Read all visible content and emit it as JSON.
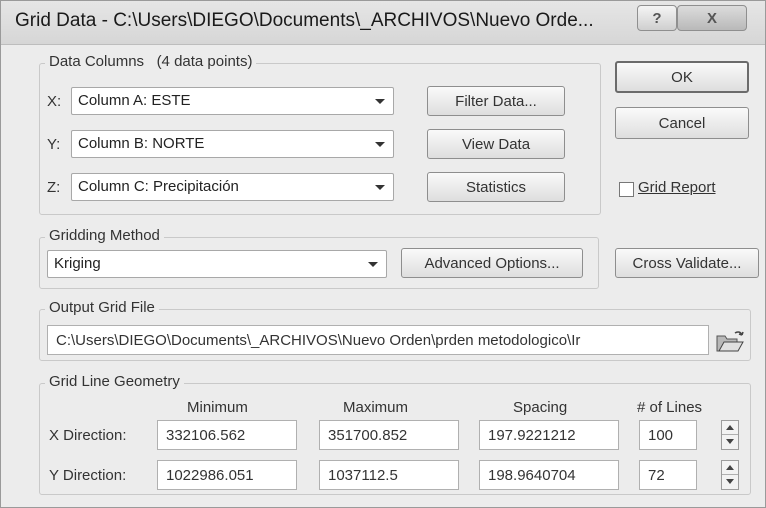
{
  "window": {
    "title": "Grid Data - C:\\Users\\DIEGO\\Documents\\_ARCHIVOS\\Nuevo Orde...",
    "help_label": "?",
    "close_label": "X"
  },
  "data_columns": {
    "legend": "Data Columns",
    "count_text": "(4 data points)",
    "x_label": "X:",
    "x_value": "Column A:  ESTE",
    "y_label": "Y:",
    "y_value": "Column B:  NORTE",
    "z_label": "Z:",
    "z_value": "Column C:  Precipitación"
  },
  "buttons": {
    "filter_data": "Filter Data...",
    "view_data": "View Data",
    "statistics": "Statistics",
    "ok": "OK",
    "cancel": "Cancel",
    "advanced_options": "Advanced Options...",
    "cross_validate": "Cross Validate..."
  },
  "grid_report": {
    "label": "Grid Report",
    "checked": false
  },
  "gridding_method": {
    "legend": "Gridding Method",
    "value": "Kriging"
  },
  "output_grid_file": {
    "legend": "Output Grid File",
    "path": "C:\\Users\\DIEGO\\Documents\\_ARCHIVOS\\Nuevo Orden\\prden metodologico\\Ir",
    "browse_icon": "folder-open-icon"
  },
  "geometry": {
    "legend": "Grid Line Geometry",
    "headers": {
      "minimum": "Minimum",
      "maximum": "Maximum",
      "spacing": "Spacing",
      "lines": "# of Lines"
    },
    "x": {
      "label": "X Direction:",
      "minimum": "332106.562",
      "maximum": "351700.852",
      "spacing": "197.9221212",
      "lines": "100"
    },
    "y": {
      "label": "Y Direction:",
      "minimum": "1022986.051",
      "maximum": "1037112.5",
      "spacing": "198.9640704",
      "lines": "72"
    }
  }
}
